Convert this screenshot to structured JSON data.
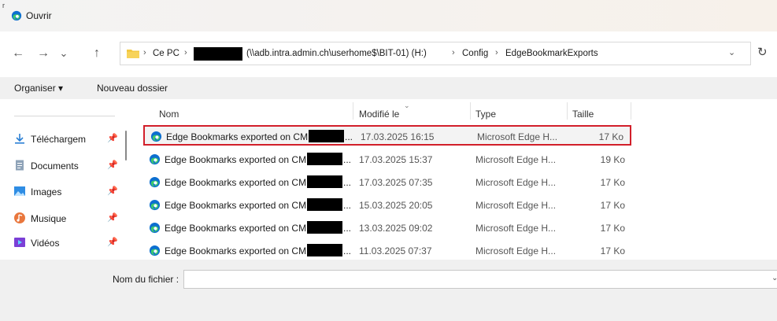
{
  "window": {
    "title": "Ouvrir",
    "corner_mark": "r"
  },
  "nav": {
    "back": "←",
    "forward": "→",
    "recent": "⌄",
    "up": "↑",
    "dropdown": "⌄",
    "refresh": "↻"
  },
  "address": {
    "crumbs": [
      "Ce PC",
      "(\\\\adb.intra.admin.ch\\userhome$\\BIT-01) (H:)",
      "Config",
      "EdgeBookmarkExports"
    ],
    "separator": "›"
  },
  "toolbar": {
    "organize": "Organiser ▾",
    "new_folder": "Nouveau dossier"
  },
  "sidebar": {
    "items": [
      {
        "label": "Téléchargem",
        "icon": "download-icon"
      },
      {
        "label": "Documents",
        "icon": "documents-icon"
      },
      {
        "label": "Images",
        "icon": "images-icon"
      },
      {
        "label": "Musique",
        "icon": "music-icon"
      },
      {
        "label": "Vidéos",
        "icon": "videos-icon"
      }
    ],
    "pin_glyph": "📌"
  },
  "columns": {
    "name": "Nom",
    "modified": "Modifié le",
    "type": "Type",
    "size": "Taille",
    "sort_caret": "⌄"
  },
  "files": [
    {
      "name": "Edge Bookmarks exported on CM",
      "ellipsis": "...",
      "date": "17.03.2025 16:15",
      "type": "Microsoft Edge H...",
      "size": "17 Ko",
      "selected": true
    },
    {
      "name": "Edge Bookmarks exported on CM",
      "ellipsis": "...",
      "date": "17.03.2025 15:37",
      "type": "Microsoft Edge H...",
      "size": "19 Ko"
    },
    {
      "name": "Edge Bookmarks exported on CM",
      "ellipsis": "...",
      "date": "17.03.2025 07:35",
      "type": "Microsoft Edge H...",
      "size": "17 Ko"
    },
    {
      "name": "Edge Bookmarks exported on CM",
      "ellipsis": "...",
      "date": "15.03.2025 20:05",
      "type": "Microsoft Edge H...",
      "size": "17 Ko"
    },
    {
      "name": "Edge Bookmarks exported on CM",
      "ellipsis": "...",
      "date": "13.03.2025 09:02",
      "type": "Microsoft Edge H...",
      "size": "17 Ko"
    },
    {
      "name": "Edge Bookmarks exported on CM",
      "ellipsis": "...",
      "date": "11.03.2025 07:37",
      "type": "Microsoft Edge H...",
      "size": "17 Ko"
    }
  ],
  "footer": {
    "filename_label": "Nom du fichier :",
    "filename_value": "",
    "dropdown": "⌄"
  },
  "colors": {
    "highlight_border": "#d21f2a",
    "edge_blue": "#0c6fd0",
    "edge_green": "#3ecb6c",
    "folder_yellow": "#f3c842"
  }
}
